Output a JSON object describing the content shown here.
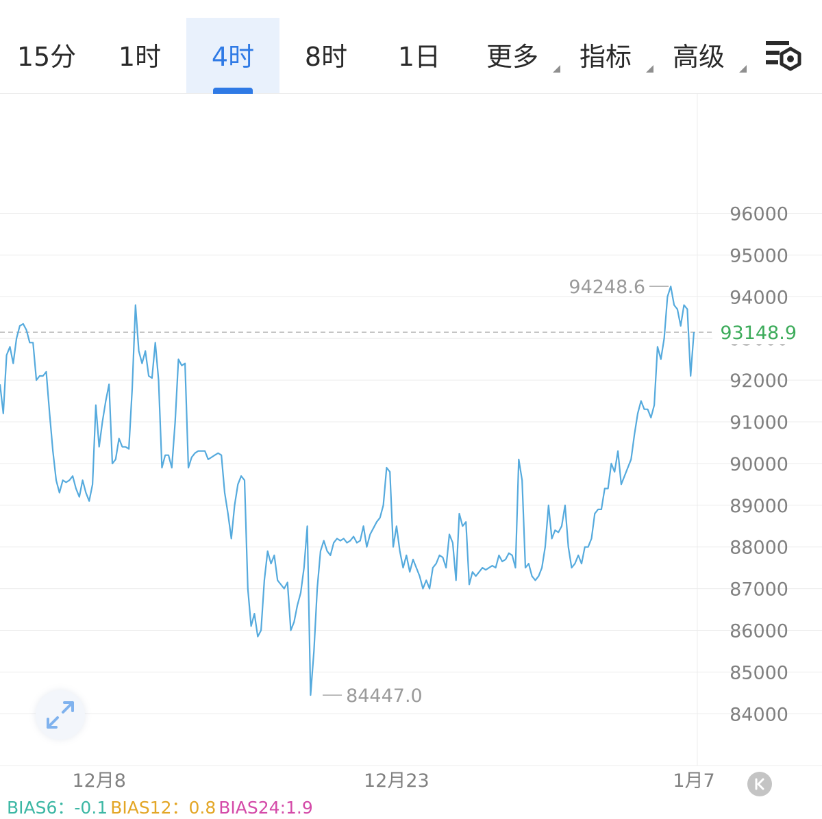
{
  "tabs": [
    {
      "label": "15分",
      "active": false,
      "more": false
    },
    {
      "label": "1时",
      "active": false,
      "more": false
    },
    {
      "label": "4时",
      "active": true,
      "more": false
    },
    {
      "label": "8时",
      "active": false,
      "more": false
    },
    {
      "label": "1日",
      "active": false,
      "more": false
    },
    {
      "label": "更多",
      "active": false,
      "more": true
    },
    {
      "label": "指标",
      "active": false,
      "more": true
    },
    {
      "label": "高级",
      "active": false,
      "more": true
    }
  ],
  "settings_icon": "chart-settings-icon",
  "colors": {
    "accent": "#2f7ae5",
    "line": "#55aadd",
    "last_price": "#3cab5a",
    "grid": "#ececec",
    "text": "#808080"
  },
  "chart_data": {
    "type": "line",
    "ylim": [
      83200,
      98400
    ],
    "yticks": [
      96000,
      95000,
      94000,
      93000,
      92000,
      91000,
      90000,
      89000,
      88000,
      87000,
      86000,
      85000,
      84000
    ],
    "xticks": [
      {
        "label": "12月8",
        "index": 30
      },
      {
        "label": "12月23",
        "index": 120
      },
      {
        "label": "1月7",
        "index": 210
      }
    ],
    "max": {
      "label": "94248.6",
      "index": 204,
      "value": 94248.6
    },
    "min": {
      "label": "84447.0",
      "index": 96,
      "value": 84447.0
    },
    "last": {
      "label": "93148.9",
      "value": 93148.9
    },
    "values": [
      91900,
      91200,
      92600,
      92800,
      92400,
      93000,
      93300,
      93350,
      93200,
      92900,
      92900,
      92000,
      92100,
      92100,
      92200,
      91200,
      90300,
      89600,
      89300,
      89600,
      89550,
      89600,
      89700,
      89400,
      89200,
      89600,
      89300,
      89100,
      89500,
      91400,
      90400,
      91000,
      91500,
      91900,
      90000,
      90100,
      90600,
      90400,
      90400,
      90350,
      91800,
      93800,
      92700,
      92400,
      92700,
      92100,
      92050,
      92900,
      92000,
      89900,
      90200,
      90200,
      89900,
      91000,
      92500,
      92350,
      92400,
      89900,
      90150,
      90250,
      90300,
      90300,
      90300,
      90100,
      90150,
      90200,
      90250,
      90200,
      89300,
      88800,
      88200,
      89000,
      89500,
      89700,
      89600,
      87000,
      86100,
      86400,
      85850,
      86000,
      87200,
      87900,
      87600,
      87800,
      87200,
      87100,
      87000,
      87150,
      86000,
      86200,
      86600,
      86900,
      87500,
      88500,
      84447,
      85500,
      87000,
      87900,
      88150,
      87900,
      87800,
      88100,
      88200,
      88150,
      88200,
      88100,
      88150,
      88250,
      88100,
      88150,
      88500,
      88000,
      88300,
      88450,
      88600,
      88700,
      89000,
      89900,
      89800,
      88000,
      88500,
      87900,
      87500,
      87800,
      87400,
      87700,
      87500,
      87300,
      87000,
      87200,
      87000,
      87500,
      87600,
      87800,
      87750,
      87500,
      88300,
      88100,
      87200,
      88800,
      88500,
      88600,
      87100,
      87400,
      87300,
      87400,
      87500,
      87450,
      87500,
      87550,
      87500,
      87800,
      87650,
      87700,
      87850,
      87800,
      87500,
      90100,
      89600,
      87500,
      87600,
      87300,
      87200,
      87300,
      87500,
      88000,
      89000,
      88200,
      88400,
      88350,
      88500,
      89000,
      88000,
      87500,
      87600,
      87800,
      87600,
      88000,
      88000,
      88200,
      88800,
      88900,
      88900,
      89400,
      89400,
      90000,
      89800,
      90300,
      89500,
      89700,
      89900,
      90100,
      90700,
      91200,
      91500,
      91300,
      91300,
      91100,
      91400,
      92800,
      92500,
      93000,
      94000,
      94248.6,
      93800,
      93700,
      93300,
      93800,
      93700,
      92100,
      93148.9
    ]
  },
  "indicators": [
    {
      "text": "BIAS6：-0.1",
      "color": "#3cb7a4"
    },
    {
      "text": "BIAS12：0.8",
      "color": "#e3a626"
    },
    {
      "text": "BIAS24:1.9",
      "color": "#d44aa8"
    }
  ]
}
